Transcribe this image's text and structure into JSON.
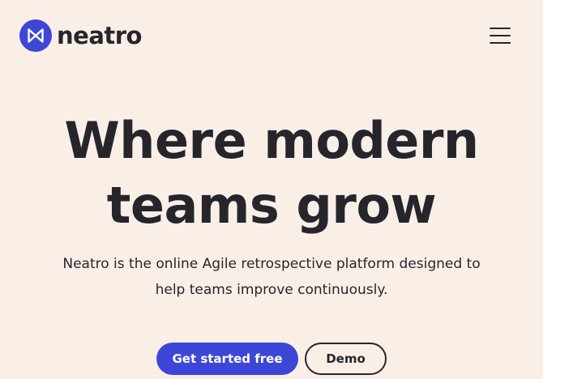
{
  "brand": {
    "name": "neatro",
    "logo_icon": "bowtie-mark-icon",
    "primary_color": "#3d46d6"
  },
  "header": {
    "menu_icon": "hamburger-menu-icon"
  },
  "hero": {
    "title_line1": "Where modern",
    "title_line2": "teams grow",
    "subtitle_line1": "Neatro is the online Agile retrospective platform designed to",
    "subtitle_line2": "help teams improve continuously."
  },
  "cta": {
    "primary_label": "Get started free",
    "secondary_label": "Demo"
  },
  "colors": {
    "background": "#faefe7",
    "text": "#26252c",
    "accent": "#3d46d6"
  }
}
